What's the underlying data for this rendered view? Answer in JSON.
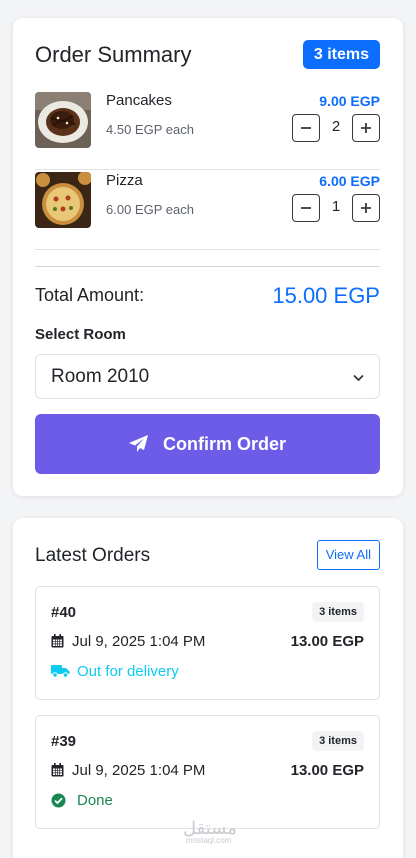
{
  "summary": {
    "title": "Order Summary",
    "count_badge": "3 items",
    "items": [
      {
        "name": "Pancakes",
        "each": "4.50 EGP each",
        "price": "9.00 EGP",
        "quantity": "2",
        "image": "pancakes-photo"
      },
      {
        "name": "Pizza",
        "each": "6.00 EGP each",
        "price": "6.00 EGP",
        "quantity": "1",
        "image": "pizza-photo"
      }
    ],
    "total_label": "Total Amount:",
    "total_value": "15.00 EGP",
    "room_label": "Select Room",
    "room_selected": "Room 2010",
    "confirm_label": "Confirm Order"
  },
  "latest": {
    "title": "Latest Orders",
    "view_all": "View All",
    "orders": [
      {
        "number": "#40",
        "items": "3 items",
        "date": "Jul 9, 2025 1:04 PM",
        "total": "13.00 EGP",
        "status": "Out for delivery",
        "status_icon": "truck-icon",
        "status_color": "#0dcaf0"
      },
      {
        "number": "#39",
        "items": "3 items",
        "date": "Jul 9, 2025 1:04 PM",
        "total": "13.00 EGP",
        "status": "Done",
        "status_icon": "check-circle-icon",
        "status_color": "#198754"
      }
    ]
  },
  "watermark": {
    "main": "مستقل",
    "sub": "mostaql.com"
  },
  "colors": {
    "primary": "#0d6efd",
    "confirm": "#6c5ce7",
    "delivery": "#0dcaf0",
    "done": "#198754"
  }
}
